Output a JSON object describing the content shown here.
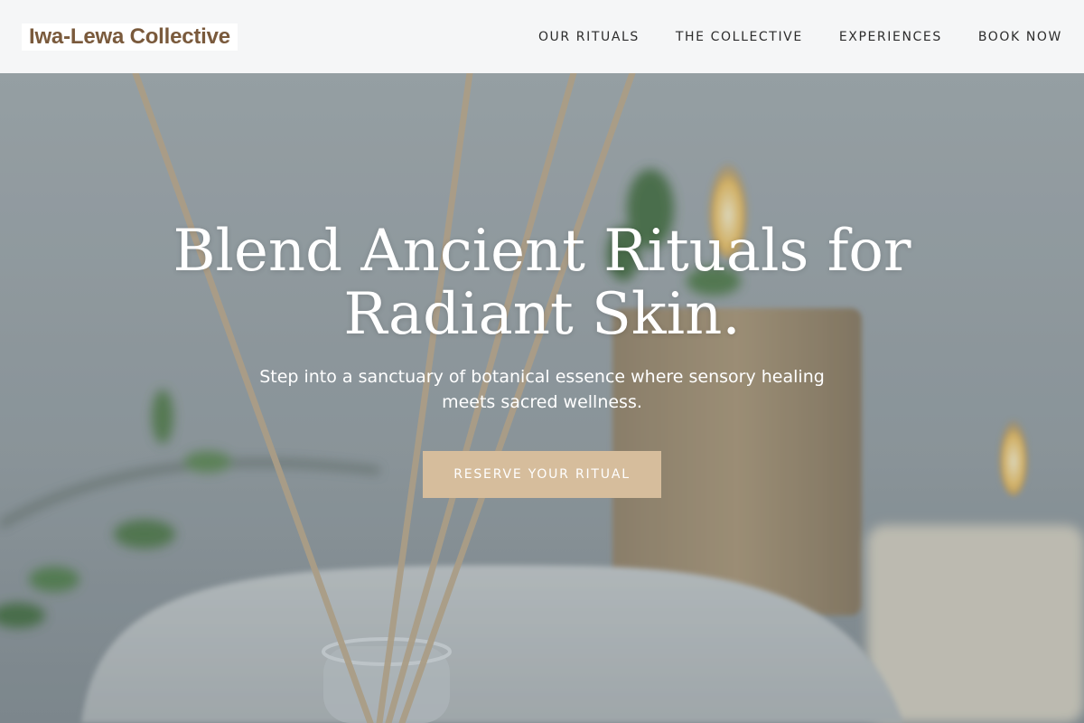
{
  "header": {
    "brand": "Iwa-Lewa Collective",
    "nav": [
      {
        "label": "OUR RITUALS"
      },
      {
        "label": "THE COLLECTIVE"
      },
      {
        "label": "EXPERIENCES"
      },
      {
        "label": "BOOK NOW"
      }
    ]
  },
  "hero": {
    "title": "Blend Ancient Rituals for Radiant Skin.",
    "subtitle": "Step into a sanctuary of botanical essence where sensory healing meets sacred wellness.",
    "cta_label": "RESERVE YOUR RITUAL"
  },
  "colors": {
    "header_bg": "#f5f6f7",
    "brand_text": "#7a5a3c",
    "cta_bg": "#d6bd9c"
  }
}
